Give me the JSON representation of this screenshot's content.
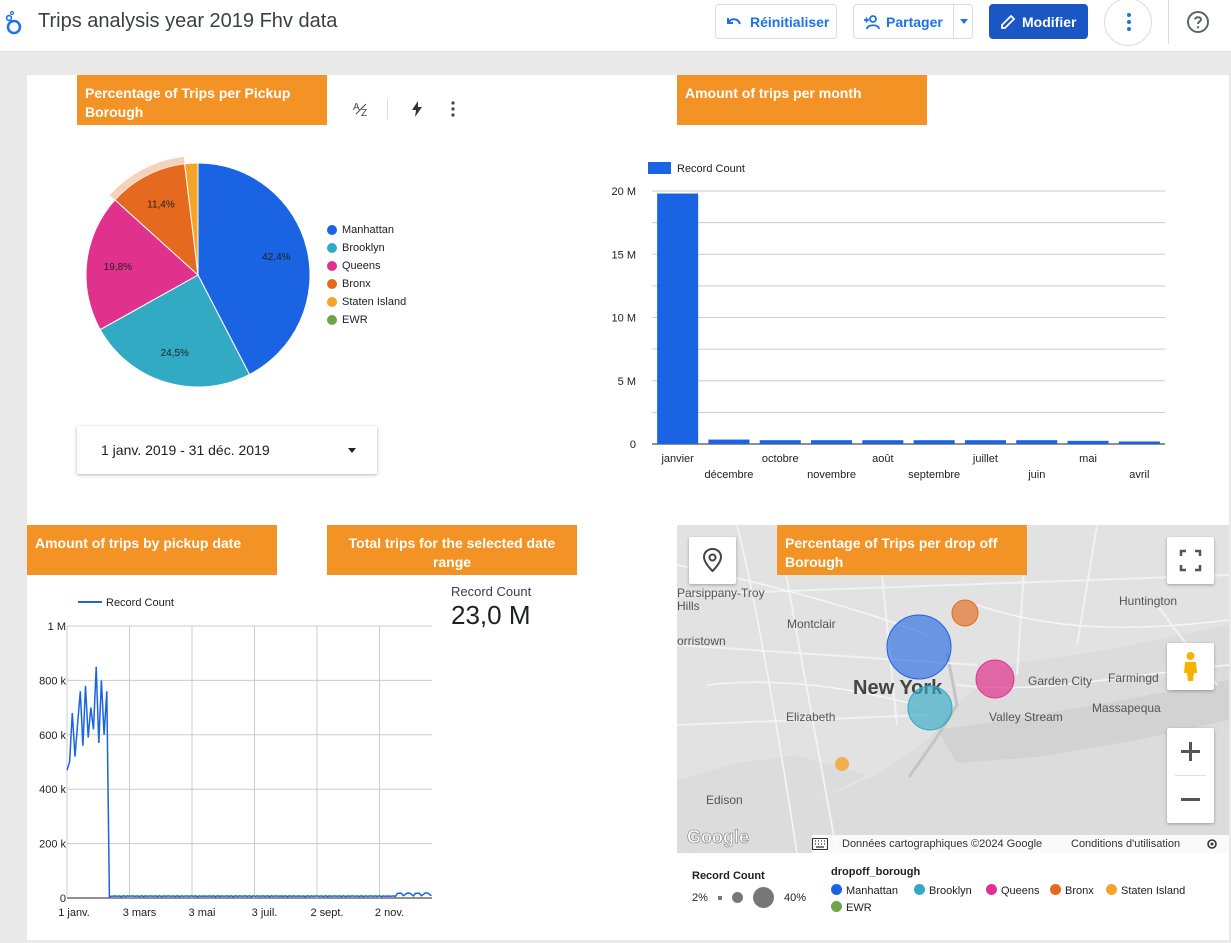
{
  "header": {
    "title": "Trips analysis year 2019 Fhv data",
    "reset_label": "Réinitialiser",
    "share_label": "Partager",
    "edit_label": "Modifier"
  },
  "colors": {
    "accent_orange": "#f39325",
    "primary_blue": "#1a56c4",
    "manhattan": "#1a63e3",
    "brooklyn": "#33aac4",
    "queens": "#e0328c",
    "bronx": "#e5691f",
    "staten_island": "#f4a529",
    "ewr": "#6ca648"
  },
  "pickup_pie": {
    "title": "Percentage of Trips per Pickup Borough",
    "legend": [
      "Manhattan",
      "Brooklyn",
      "Queens",
      "Bronx",
      "Staten Island",
      "EWR"
    ],
    "labels": [
      "42,4%",
      "24,5%",
      "19,8%",
      "11,4%"
    ]
  },
  "date_range": {
    "label": "1 janv. 2019 - 31 déc. 2019"
  },
  "chart_data": [
    {
      "type": "pie",
      "title": "Percentage of Trips per Pickup Borough",
      "categories": [
        "Manhattan",
        "Brooklyn",
        "Queens",
        "Bronx",
        "Staten Island",
        "EWR"
      ],
      "values": [
        42.4,
        24.5,
        19.8,
        11.4,
        1.9,
        0.0
      ]
    },
    {
      "type": "bar",
      "title": "Amount of trips per month",
      "series": [
        {
          "name": "Record Count",
          "values": [
            19.8,
            0.35,
            0.3,
            0.3,
            0.3,
            0.3,
            0.3,
            0.3,
            0.25,
            0.2
          ]
        }
      ],
      "categories": [
        "janvier",
        "décembre",
        "octobre",
        "novembre",
        "août",
        "septembre",
        "juillet",
        "juin",
        "mai",
        "avril"
      ],
      "ylim": [
        0,
        20
      ],
      "yticks": [
        "0",
        "5 M",
        "10 M",
        "15 M",
        "20 M"
      ],
      "legend": "top-left",
      "grid": true
    },
    {
      "type": "line",
      "title": "Amount of trips by pickup date",
      "series": [
        {
          "name": "Record Count"
        }
      ],
      "xticks": [
        "1 janv.",
        "3 mars",
        "3 mai",
        "3 juil.",
        "2 sept.",
        "2 nov."
      ],
      "yticks": [
        "0",
        "200 k",
        "400 k",
        "600 k",
        "800 k",
        "1 M"
      ],
      "ylim": [
        0,
        1000000
      ],
      "legend": "top-left",
      "grid": true
    }
  ],
  "monthly_bar": {
    "title": "Amount of trips per month",
    "legend": "Record Count"
  },
  "pickup_line": {
    "title": "Amount of trips by pickup date",
    "legend": "Record Count"
  },
  "scorecard": {
    "title": "Total trips for the selected date range",
    "label": "Record Count",
    "value": "23,0 M"
  },
  "dropoff_map": {
    "title": "Percentage of Trips per drop off Borough",
    "places": [
      "Parsippany-Troy Hills",
      "Montclair",
      "orristown",
      "Huntington",
      "Garden City",
      "Farmingd",
      "Massapequa",
      "Valley Stream",
      "Elizabeth",
      "Edison",
      "New York"
    ],
    "attribution": "Données cartographiques ©2024 Google",
    "terms": "Conditions d'utilisation",
    "size_legend_title": "Record Count",
    "size_min": "2%",
    "size_max": "40%",
    "color_legend_title": "dropoff_borough",
    "color_legend": [
      "Manhattan",
      "Brooklyn",
      "Queens",
      "Bronx",
      "Staten Island",
      "EWR"
    ]
  }
}
